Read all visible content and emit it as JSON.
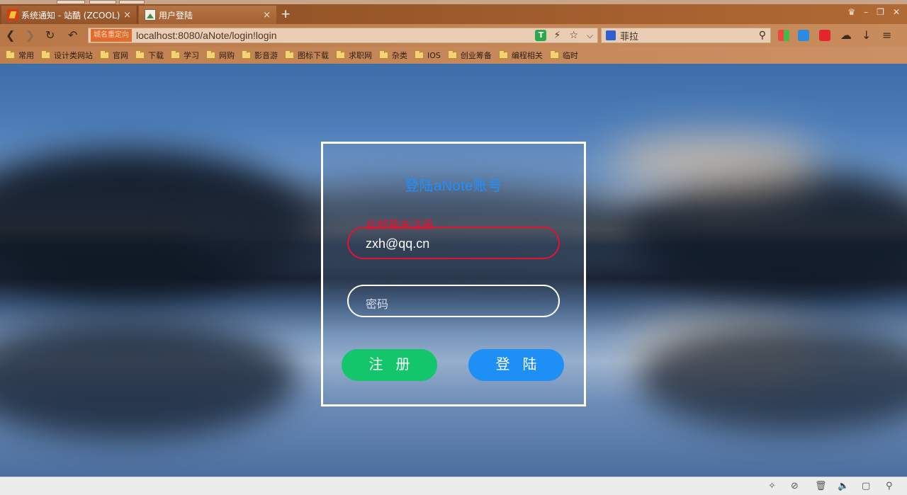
{
  "browser": {
    "tabs": [
      {
        "title": "系统通知 - 站酷 (ZCOOL)",
        "active": false
      },
      {
        "title": "用户登陆",
        "active": true
      }
    ],
    "new_tab_symbol": "+",
    "tab_close_symbol": "×",
    "url_badge": "城名重定向",
    "url": "localhost:8080/aNote/login!login",
    "search_query": "菲拉",
    "bookmarks": [
      "常用",
      "设计类网站",
      "官网",
      "下载",
      "学习",
      "网购",
      "影音游",
      "图标下载",
      "求职网",
      "杂类",
      "IOS",
      "创业筹备",
      "编程相关",
      "临时"
    ]
  },
  "login": {
    "heading": "登陆aNote账号",
    "email_error": "此邮箱未注册",
    "email_value": "zxh@qq.cn",
    "password_placeholder": "密码",
    "register_label": "注册",
    "login_label": "登陆"
  },
  "colors": {
    "heading": "#1e90ff",
    "error": "#e4122e",
    "register_button": "#14c66b",
    "login_button": "#1e8ff5"
  }
}
